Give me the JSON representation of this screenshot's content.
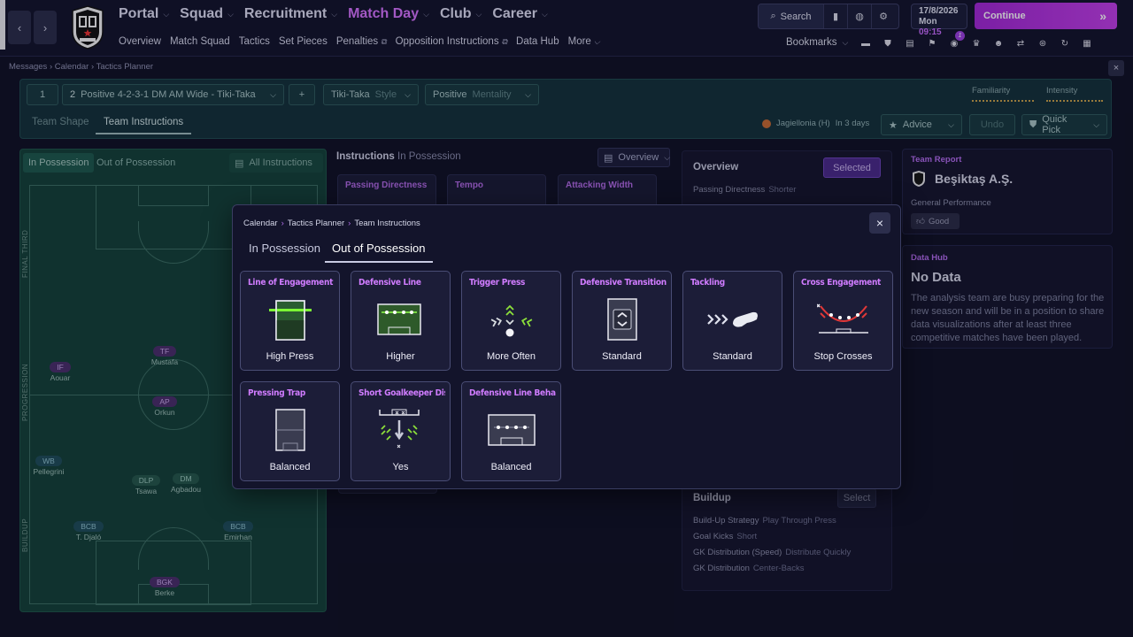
{
  "nav": {
    "back": "‹",
    "forward": "›",
    "main": [
      {
        "label": "Portal"
      },
      {
        "label": "Squad"
      },
      {
        "label": "Recruitment"
      },
      {
        "label": "Match Day"
      },
      {
        "label": "Club"
      },
      {
        "label": "Career"
      }
    ],
    "sub": [
      "Overview",
      "Match Squad",
      "Tactics",
      "Set Pieces",
      "Penalties",
      "Opposition Instructions",
      "Data Hub",
      "More"
    ],
    "search_label": "Search",
    "date": "17/8/2026",
    "day": "Mon",
    "time": "09:15",
    "continue_label": "Continue",
    "bookmarks_label": "Bookmarks",
    "notification_count": "1",
    "accent": "#d673ff"
  },
  "breadcrumb": [
    "Messages",
    "Calendar",
    "Tactics Planner"
  ],
  "tactic_bar": {
    "slot": "1",
    "formation_num": "2",
    "formation": "Positive 4-2-3-1 DM AM Wide - Tiki-Taka",
    "add": "+",
    "style_value": "Tiki-Taka",
    "style_label": "Style",
    "mentality_value": "Positive",
    "mentality_label": "Mentality",
    "familiarity": "Familiarity",
    "intensity": "Intensity",
    "tabs": [
      "Team Shape",
      "Team Instructions"
    ],
    "opponent": "Jagiellonia (H)",
    "opponent_when": "In 3 days",
    "advice": "Advice",
    "undo": "Undo",
    "quick_pick": "Quick Pick"
  },
  "pitch": {
    "tabs": [
      "In Possession",
      "Out of Possession"
    ],
    "all_instructions": "All Instructions",
    "zones": [
      "FINAL THIRD",
      "PROGRESSION",
      "BUILDUP"
    ],
    "players": [
      {
        "role": "TF",
        "name": "Mustafa"
      },
      {
        "role": "IF",
        "name": "Aouar"
      },
      {
        "role": "AP",
        "name": "Orkun"
      },
      {
        "role": "WB",
        "name": "Pellegrini"
      },
      {
        "role": "DLP",
        "name": "Tsawa"
      },
      {
        "role": "DM",
        "name": "Agbadou"
      },
      {
        "role": "BCB",
        "name": "T. Djaló"
      },
      {
        "role": "BCB",
        "name": "Emirhan"
      },
      {
        "role": "BGK",
        "name": "Berke"
      }
    ]
  },
  "instructions": {
    "title": "Instructions",
    "subtitle": "In Possession",
    "view": "Overview",
    "bg_cards": [
      "Passing Directness",
      "Tempo",
      "Attacking Width"
    ]
  },
  "overview": {
    "title": "Overview",
    "selected_btn": "Selected",
    "row1_label": "Passing Directness",
    "row1_value": "Shorter",
    "buildup_title": "Buildup",
    "select_btn": "Select",
    "buildup_rows": [
      {
        "label": "Build-Up Strategy",
        "value": "Play Through Press"
      },
      {
        "label": "Goal Kicks",
        "value": "Short"
      },
      {
        "label": "GK Distribution (Speed)",
        "value": "Distribute Quickly"
      },
      {
        "label": "GK Distribution",
        "value": "Center-Backs"
      }
    ]
  },
  "team_report": {
    "label": "Team Report",
    "club": "Beşiktaş A.Ş.",
    "perf_label": "General Performance",
    "perf_value": "Good"
  },
  "data_hub": {
    "label": "Data Hub",
    "title": "No Data",
    "text": "The analysis team are busy preparing for the new season and will be in a position to share data visualizations after at least three competitive matches have been played."
  },
  "modal": {
    "breadcrumb": [
      "Calendar",
      "Tactics Planner",
      "Team Instructions"
    ],
    "close": "×",
    "tabs": [
      "In Possession",
      "Out of Possession"
    ],
    "cards": [
      {
        "title": "Line of Engagement",
        "value": "High Press"
      },
      {
        "title": "Defensive Line",
        "value": "Higher"
      },
      {
        "title": "Trigger Press",
        "value": "More Often"
      },
      {
        "title": "Defensive Transition",
        "value": "Standard"
      },
      {
        "title": "Tackling",
        "value": "Standard"
      },
      {
        "title": "Cross Engagement",
        "value": "Stop Crosses"
      },
      {
        "title": "Pressing Trap",
        "value": "Balanced"
      },
      {
        "title": "Short Goalkeeper Distribution",
        "value": "Yes"
      },
      {
        "title": "Defensive Line Behaviour",
        "value": "Balanced"
      }
    ]
  }
}
